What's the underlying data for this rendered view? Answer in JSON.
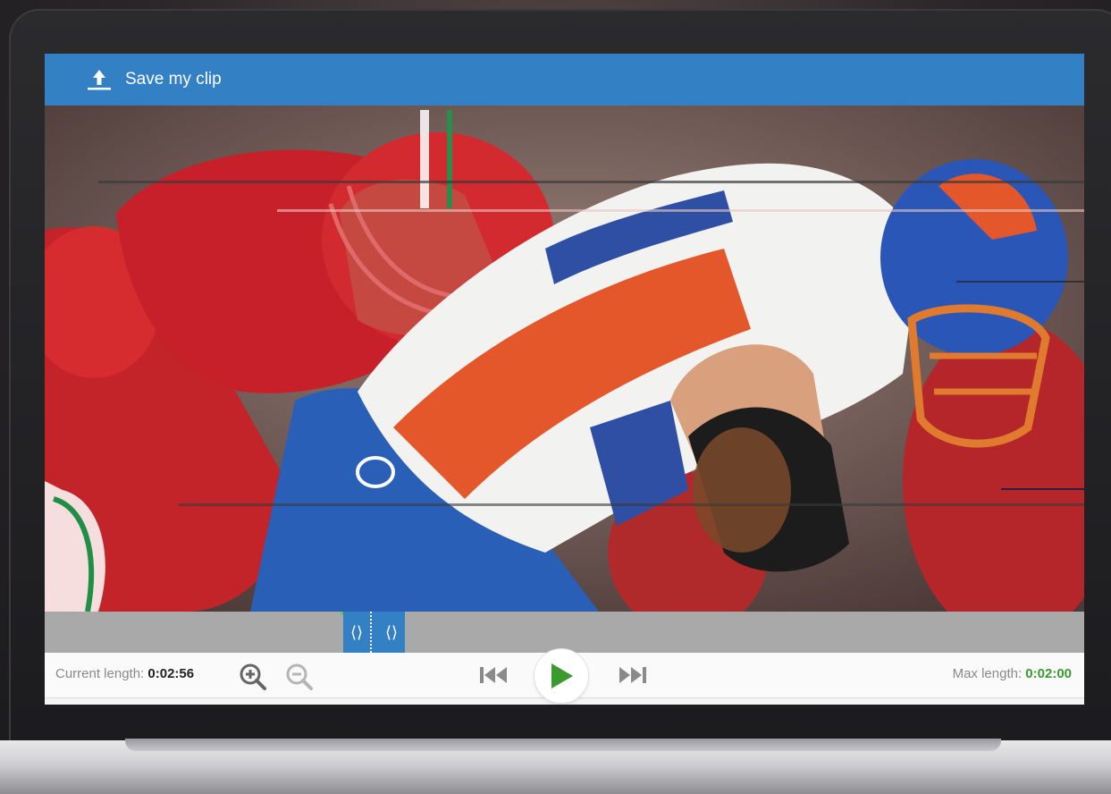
{
  "toolbar": {
    "save_label": "Save my clip",
    "save_icon": "upload-icon",
    "bar_color": "#3380c4"
  },
  "video": {
    "description_icon": "video-frame"
  },
  "timeline": {
    "left_handle_glyph": "⟨⟩",
    "right_handle_glyph": "⟨⟩",
    "handle_color": "#3380c4",
    "marker_color": "#6fbe44"
  },
  "controls": {
    "current_length_label": "Current length:",
    "current_length_value": "0:02:56",
    "zoom_in_icon": "zoom-in-icon",
    "zoom_out_icon": "zoom-out-icon",
    "prev_icon": "skip-back-icon",
    "play_icon": "play-icon",
    "next_icon": "skip-forward-icon",
    "max_length_label": "Max length:",
    "max_length_value": "0:02:00",
    "play_color": "#3a9a2e"
  }
}
